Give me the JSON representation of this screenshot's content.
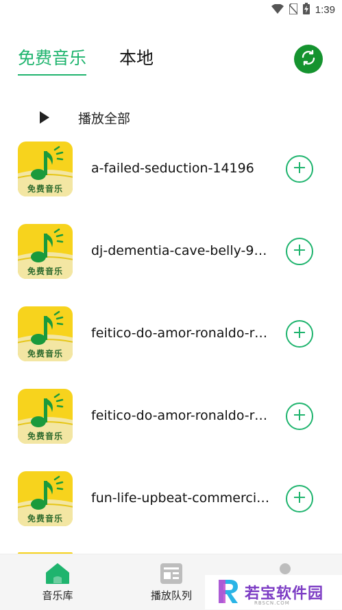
{
  "status_bar": {
    "time": "1:39"
  },
  "header": {
    "tabs": [
      {
        "label": "免费音乐",
        "active": true
      },
      {
        "label": "本地",
        "active": false
      }
    ]
  },
  "play_all": {
    "label": "播放全部"
  },
  "cover_text": "免费音乐",
  "songs": [
    {
      "title": "a-failed-seduction-14196"
    },
    {
      "title": "dj-dementia-cave-belly-95…"
    },
    {
      "title": "feitico-do-amor-ronaldo-re…"
    },
    {
      "title": "feitico-do-amor-ronaldo-re…"
    },
    {
      "title": "fun-life-upbeat-commerci…"
    }
  ],
  "bottom_nav": {
    "items": [
      {
        "label": "音乐库",
        "icon": "home-icon"
      },
      {
        "label": "播放队列",
        "icon": "queue-icon"
      },
      {
        "label": "",
        "icon": "profile-icon"
      }
    ]
  },
  "watermark": {
    "text": "若宝软件园",
    "sub": "RBSCN.COM"
  },
  "colors": {
    "accent": "#1fb46e",
    "refresh": "#15932f",
    "cover": "#f7d31d"
  }
}
